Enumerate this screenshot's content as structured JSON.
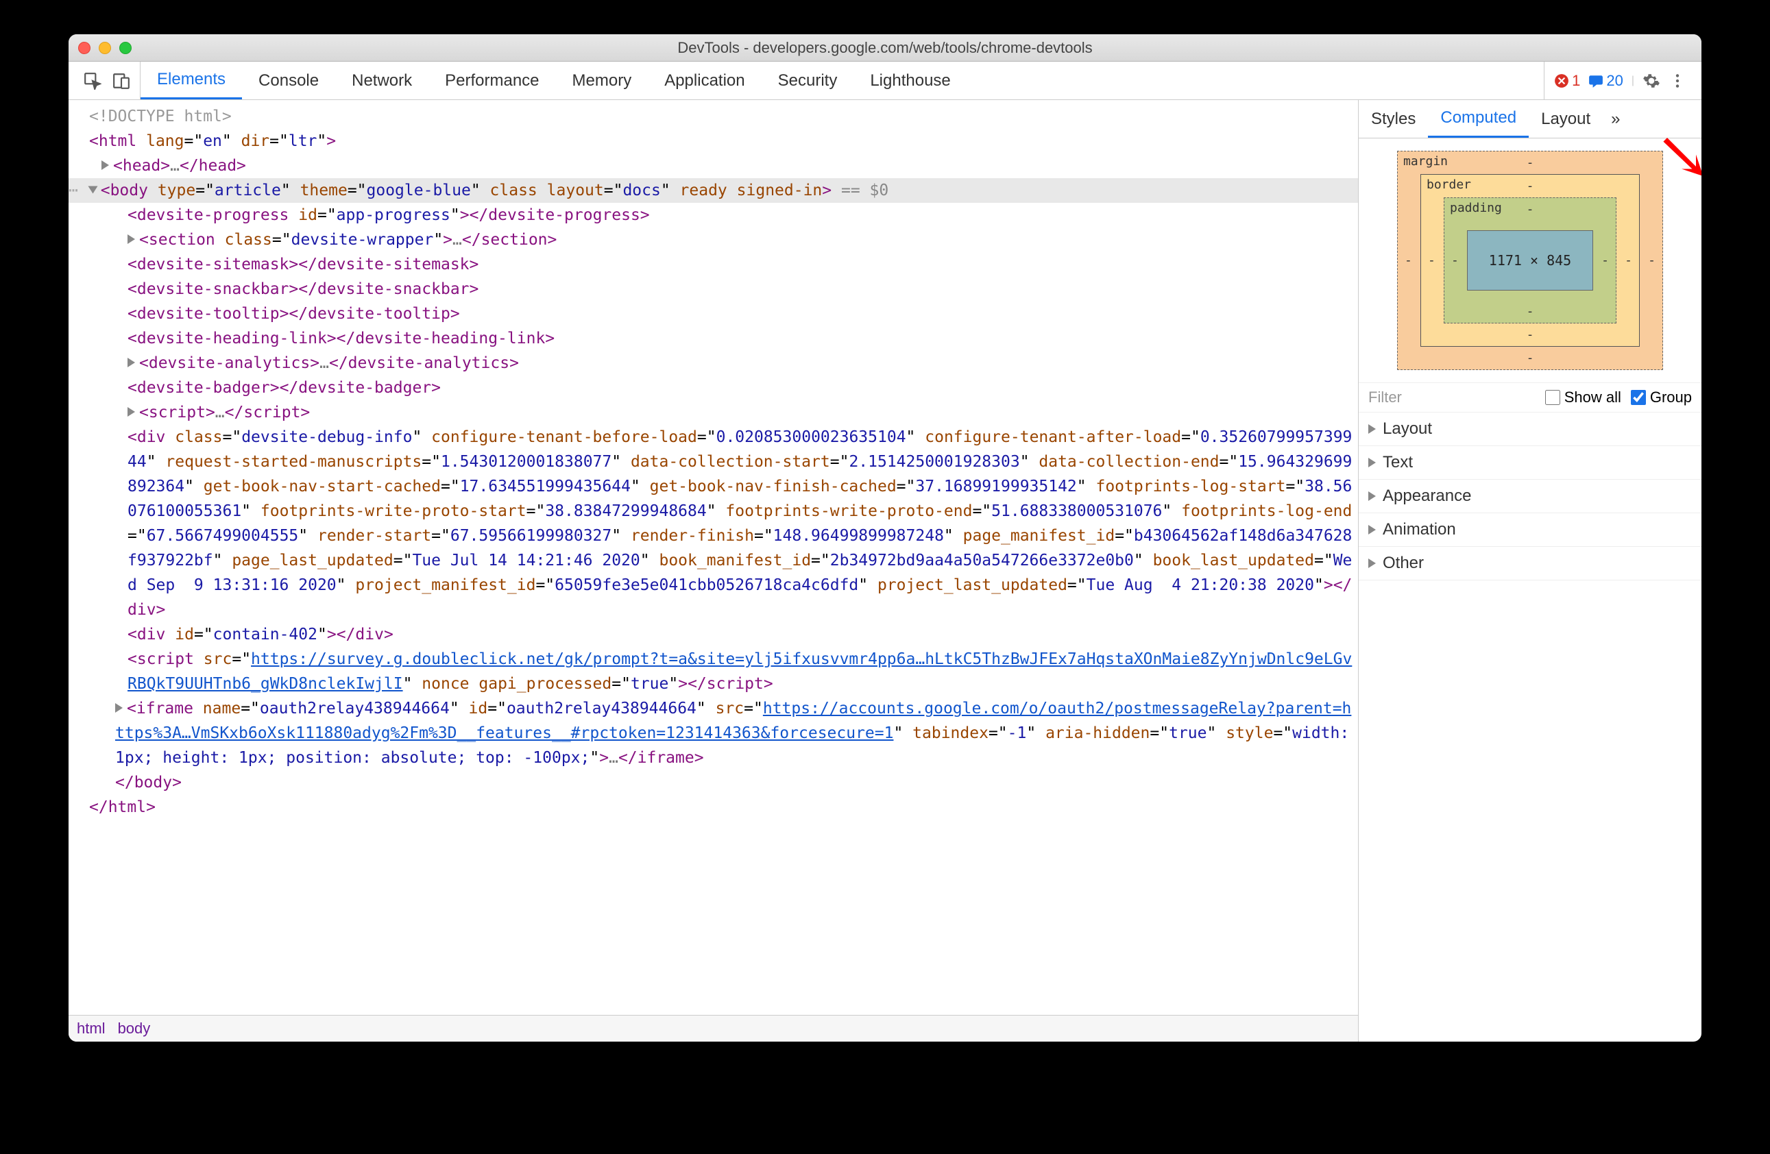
{
  "os": "mac",
  "window_title": "DevTools - developers.google.com/web/tools/chrome-devtools",
  "main_tabs": [
    "Elements",
    "Console",
    "Network",
    "Performance",
    "Memory",
    "Application",
    "Security",
    "Lighthouse"
  ],
  "active_main_tab": 0,
  "errors": {
    "count": "1"
  },
  "messages": {
    "count": "20"
  },
  "side_tabs": [
    "Styles",
    "Computed",
    "Layout"
  ],
  "active_side_tab": 1,
  "box_model": {
    "margin": "margin",
    "border": "border",
    "padding": "padding",
    "content": "1171 × 845",
    "dash": "-"
  },
  "filter_label": "Filter",
  "show_all_label": "Show all",
  "show_all_checked": false,
  "group_label": "Group",
  "group_checked": true,
  "computed_sections": [
    "Layout",
    "Text",
    "Appearance",
    "Animation",
    "Other"
  ],
  "breadcrumbs": [
    "html",
    "body"
  ],
  "dom": {
    "doctype": "<!DOCTYPE html>",
    "html_open": {
      "tag": "html",
      "attrs": [
        [
          "lang",
          "en"
        ],
        [
          "dir",
          "ltr"
        ]
      ]
    },
    "head": {
      "tag": "head"
    },
    "body_open": {
      "tag": "body",
      "attrs": [
        [
          "type",
          "article"
        ],
        [
          "theme",
          "google-blue"
        ],
        [
          "class",
          ""
        ],
        [
          "layout",
          "docs"
        ],
        [
          "ready",
          ""
        ],
        [
          "signed-in",
          ""
        ]
      ],
      "eq": "== $0"
    },
    "lines": [
      {
        "tag": "devsite-progress",
        "attrs": [
          [
            "id",
            "app-progress"
          ]
        ],
        "close": "devsite-progress"
      },
      {
        "tag": "section",
        "attrs": [
          [
            "class",
            "devsite-wrapper"
          ]
        ],
        "ell": true,
        "close": "section",
        "exp": true
      },
      {
        "tag": "devsite-sitemask",
        "close": "devsite-sitemask"
      },
      {
        "tag": "devsite-snackbar",
        "close": "devsite-snackbar"
      },
      {
        "tag": "devsite-tooltip",
        "close": "devsite-tooltip"
      },
      {
        "tag": "devsite-heading-link",
        "close": "devsite-heading-link"
      },
      {
        "tag": "devsite-analytics",
        "ell": true,
        "close": "devsite-analytics",
        "exp": true
      },
      {
        "tag": "devsite-badger",
        "close": "devsite-badger"
      },
      {
        "tag": "script",
        "ell": true,
        "close": "script",
        "exp": true
      }
    ],
    "bigdiv": {
      "text_open_tag": "div",
      "attrs": [
        [
          "class",
          "devsite-debug-info"
        ],
        [
          "configure-tenant-before-load",
          "0.020853000023635104"
        ],
        [
          "configure-tenant-after-load",
          "0.3526079995739944"
        ],
        [
          "request-started-manuscripts",
          "1.5430120001838077"
        ],
        [
          "data-collection-start",
          "2.1514250001928303"
        ],
        [
          "data-collection-end",
          "15.964329699892364"
        ],
        [
          "get-book-nav-start-cached",
          "17.634551999435644"
        ],
        [
          "get-book-nav-finish-cached",
          "37.16899199935142"
        ],
        [
          "footprints-log-start",
          "38.56076100055361"
        ],
        [
          "footprints-write-proto-start",
          "38.83847299948684"
        ],
        [
          "footprints-write-proto-end",
          "51.688338000531076"
        ],
        [
          "footprints-log-end",
          "67.5667499004555"
        ],
        [
          "render-start",
          "67.59566199980327"
        ],
        [
          "render-finish",
          "148.96499899987248"
        ],
        [
          "page_manifest_id",
          "b43064562af148d6a347628f937922bf"
        ],
        [
          "page_last_updated",
          "Tue Jul 14 14:21:46 2020"
        ],
        [
          "book_manifest_id",
          "2b34972bd9aa4a50a547266e3372e0b0"
        ],
        [
          "book_last_updated",
          "Wed Sep  9 13:31:16 2020"
        ],
        [
          "project_manifest_id",
          "65059fe3e5e041cbb0526718ca4c6dfd"
        ],
        [
          "project_last_updated",
          "Tue Aug  4 21:20:38 2020"
        ]
      ],
      "close": "div"
    },
    "contain_div": {
      "tag": "div",
      "attrs": [
        [
          "id",
          "contain-402"
        ]
      ],
      "close": "div"
    },
    "script_src": {
      "tag": "script",
      "src": "https://survey.g.doubleclick.net/gk/prompt?t=a&site=ylj5ifxusvvmr4pp6a…hLtkC5ThzBwJFEx7aHqstaXOnMaie8ZyYnjwDnlc9eLGvRBQkT9UUHTnb6_gWkD8nclekIwjlI",
      "tail_attrs": [
        [
          "nonce",
          ""
        ],
        [
          "gapi_processed",
          "true"
        ]
      ],
      "close": "script"
    },
    "iframe": {
      "tag": "iframe",
      "attrs": [
        [
          "name",
          "oauth2relay438944664"
        ],
        [
          "id",
          "oauth2relay438944664"
        ]
      ],
      "src": "https://accounts.google.com/o/oauth2/postmessageRelay?parent=https%3A…VmSKxb6oXsk111880adyg%2Fm%3D__features__#rpctoken=1231414363&forcesecure=1",
      "tail_attrs": [
        [
          "tabindex",
          "-1"
        ],
        [
          "aria-hidden",
          "true"
        ],
        [
          "style",
          "width: 1px; height: 1px; position: absolute; top: -100px;"
        ]
      ],
      "ell": true,
      "close": "iframe"
    },
    "body_close": "body",
    "html_close": "html"
  }
}
